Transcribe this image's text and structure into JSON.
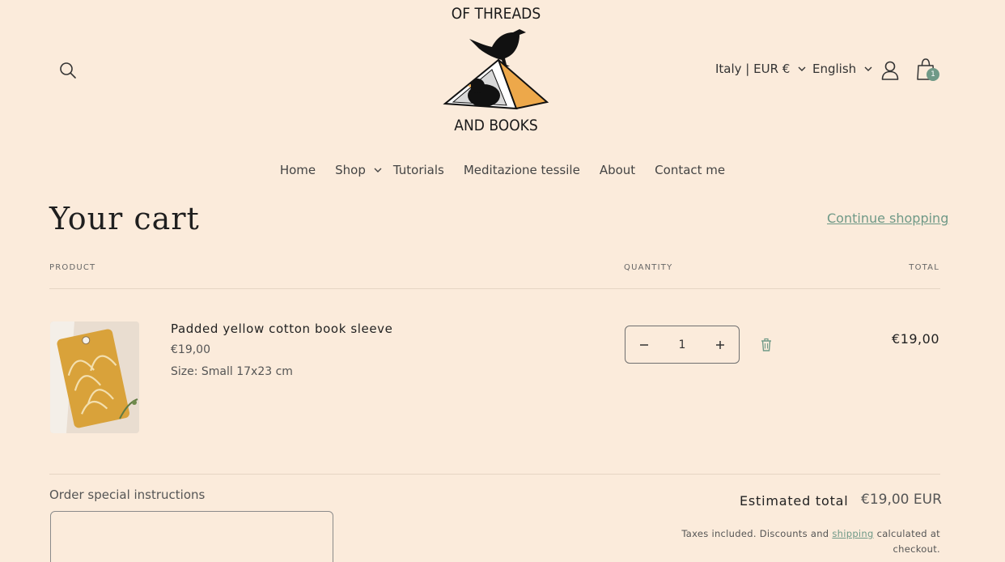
{
  "header": {
    "logo_top": "OF THREADS",
    "logo_bottom": "AND BOOKS",
    "country_selector": "Italy | EUR €",
    "language_selector": "English",
    "cart_count": "1"
  },
  "nav": {
    "items": [
      {
        "label": "Home"
      },
      {
        "label": "Shop"
      },
      {
        "label": "Tutorials"
      },
      {
        "label": "Meditazione tessile"
      },
      {
        "label": "About"
      },
      {
        "label": "Contact me"
      }
    ]
  },
  "cart": {
    "title": "Your cart",
    "continue_label": "Continue shopping",
    "columns": {
      "product": "PRODUCT",
      "quantity": "QUANTITY",
      "total": "TOTAL"
    },
    "items": [
      {
        "name": "Padded yellow cotton book sleeve",
        "price": "€19,00",
        "variant": "Size: Small 17x23 cm",
        "quantity": "1",
        "line_total": "€19,00"
      }
    ],
    "instructions_label": "Order special instructions",
    "estimated_total_label": "Estimated total",
    "estimated_total_value": "€19,00 EUR",
    "tax_note_before": "Taxes included. Discounts and ",
    "tax_note_link": "shipping",
    "tax_note_after": " calculated at checkout."
  },
  "colors": {
    "background": "#fbebdb",
    "accent": "#6f9987",
    "book_orange": "#eda84a"
  }
}
